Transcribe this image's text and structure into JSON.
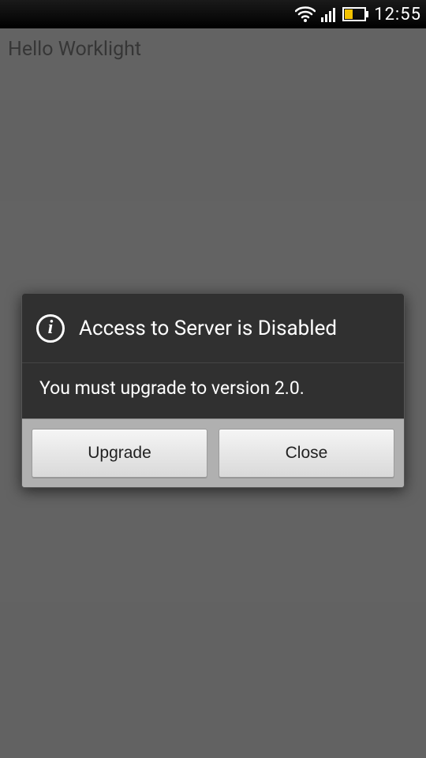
{
  "statusbar": {
    "time": "12:55"
  },
  "page": {
    "title": "Hello Worklight"
  },
  "dialog": {
    "title": "Access to Server is Disabled",
    "message": "You must upgrade to version 2.0.",
    "buttons": {
      "upgrade": "Upgrade",
      "close": "Close"
    }
  }
}
